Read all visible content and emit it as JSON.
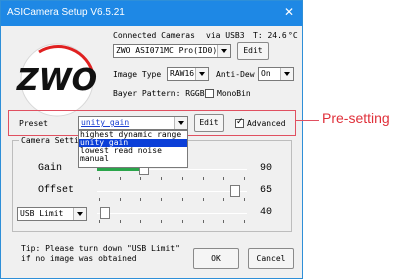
{
  "window": {
    "title": "ASICamera Setup V6.5.21",
    "close_glyph": "✕"
  },
  "logo": {
    "text": "ZWO"
  },
  "camera": {
    "connected_label": "Connected Cameras",
    "via_label": "via USB3",
    "temperature": "T: 24.6",
    "temperature_unit": "°C",
    "selected_camera": "ZWO ASI071MC Pro(ID0)",
    "edit_label": "Edit",
    "image_type_label": "Image Type",
    "image_type_value": "RAW16",
    "anti_dew_label": "Anti-Dew",
    "anti_dew_value": "On",
    "bayer_label": "Bayer Pattern: RGGB",
    "monobin_label": "MonoBin",
    "monobin_checked": false
  },
  "preset": {
    "label": "Preset",
    "value": "unity gain",
    "edit_label": "Edit",
    "advanced_label": "Advanced",
    "advanced_checked": true,
    "options": [
      "highest dynamic range",
      "unity gain",
      "lowest read noise",
      "manual"
    ],
    "selected_index": 1
  },
  "callout": {
    "text": "Pre-setting",
    "color": "#e0303a"
  },
  "camera_settings": {
    "group_title": "Camera Settings",
    "gain": {
      "label": "Gain",
      "value": "90",
      "fraction": 0.3
    },
    "offset": {
      "label": "Offset",
      "value": "65",
      "fraction": 0.95
    },
    "usb": {
      "select_value": "USB Limit",
      "value": "40",
      "fraction": 0.02
    }
  },
  "tip": {
    "line1": "Tip: Please turn down \"USB Limit\"",
    "line2": "if no image was obtained"
  },
  "buttons": {
    "ok_label": "OK",
    "cancel_label": "Cancel"
  },
  "colors": {
    "titlebar": "#1e88e5",
    "selection": "#0b3fd8",
    "gain_fill": "#2aa54a",
    "highlight_box": "#e05060"
  }
}
